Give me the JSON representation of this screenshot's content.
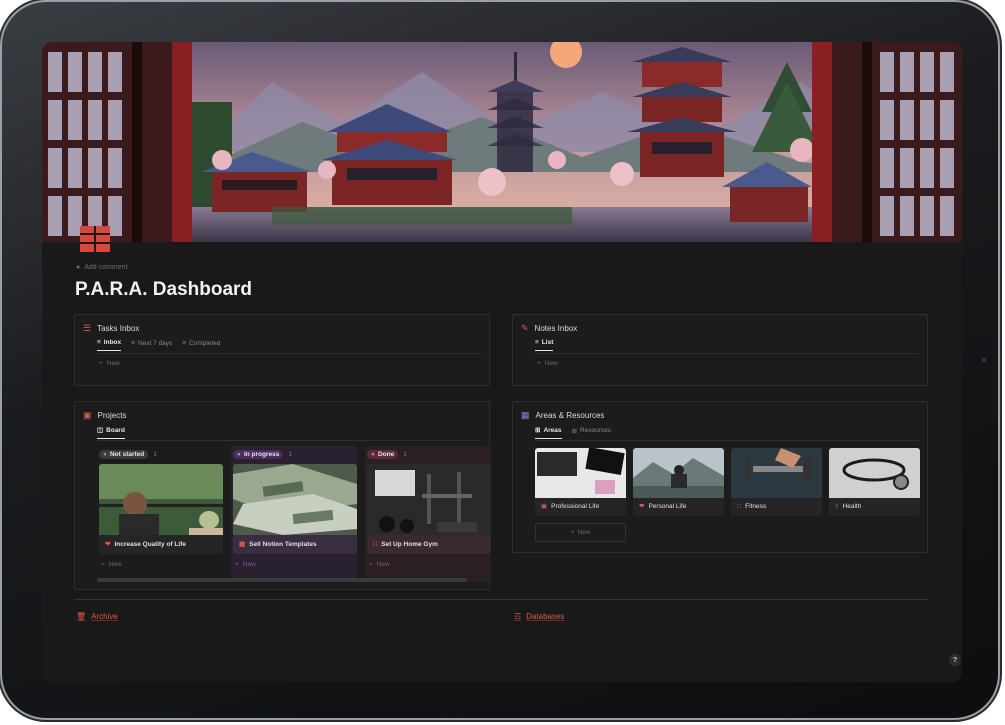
{
  "page": {
    "add_comment": "Add comment",
    "title": "P.A.R.A. Dashboard",
    "icon": "red-grid-icon"
  },
  "tasks": {
    "title": "Tasks Inbox",
    "icon": "checklist-icon",
    "views": [
      "Inbox",
      "Next 7 days",
      "Completed"
    ],
    "active_view": "Inbox",
    "new_label": "New"
  },
  "notes": {
    "title": "Notes Inbox",
    "icon": "pencil-icon",
    "views": [
      "List"
    ],
    "active_view": "List",
    "new_label": "New"
  },
  "projects": {
    "title": "Projects",
    "icon": "briefcase-icon",
    "views": [
      "Board"
    ],
    "active_view": "Board",
    "columns": [
      {
        "status": "Not started",
        "count": "1",
        "color": "#3a3a3a",
        "dot": "#8a8a8a",
        "card": "Increase Quality of Life",
        "card_icon": "heart-icon",
        "new_label": "New"
      },
      {
        "status": "In progress",
        "count": "1",
        "color": "#4a2d5a",
        "dot": "#b37fd6",
        "card": "Sell Notion Templates",
        "card_icon": "money-icon",
        "new_label": "New"
      },
      {
        "status": "Done",
        "count": "1",
        "color": "#5a2a36",
        "dot": "#e0708a",
        "card": "Set Up Home Gym",
        "card_icon": "dumbbell-icon",
        "new_label": "New"
      }
    ]
  },
  "areas": {
    "title": "Areas & Resources",
    "icon": "grid-icon",
    "views": [
      "Areas",
      "Resources"
    ],
    "active_view": "Areas",
    "cards": [
      {
        "label": "Professional Life",
        "icon": "briefcase-icon"
      },
      {
        "label": "Personal Life",
        "icon": "heart-icon"
      },
      {
        "label": "Fitness",
        "icon": "dumbbell-icon"
      },
      {
        "label": "Health",
        "icon": "stethoscope-icon"
      }
    ],
    "new_label": "New"
  },
  "footer": {
    "archive": "Archive",
    "databases": "Databases",
    "help": "?"
  },
  "colors": {
    "accent": "#e05a4f",
    "background": "#191919",
    "card": "#1c1c1c"
  }
}
